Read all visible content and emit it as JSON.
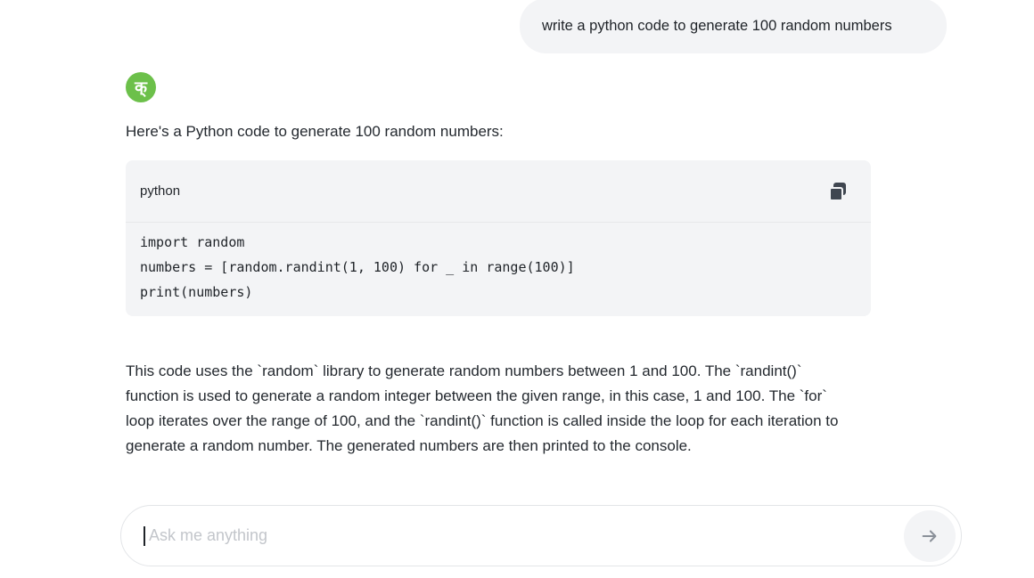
{
  "conversation": {
    "user_message": "write a python code to generate 100 random numbers",
    "assistant": {
      "avatar_glyph": "क्",
      "avatar_color": "#6cc04a",
      "intro": "Here's a Python code to generate 100 random numbers:",
      "code": {
        "language": "python",
        "copy_icon": "copy-icon",
        "lines": [
          "import random",
          "numbers = [random.randint(1, 100) for _ in range(100)]",
          "print(numbers)"
        ]
      },
      "explanation": [
        "This code uses the `random` library to generate random numbers between 1 and 100. The `randint()`",
        "function is used to generate a random integer between the given range, in this case, 1 and 100. The `for`",
        "loop iterates over the range of 100, and the `randint()` function is called inside the loop for each iteration to",
        "generate a random number. The generated numbers are then printed to the console."
      ]
    }
  },
  "composer": {
    "placeholder": "Ask me anything",
    "value": "",
    "send_icon": "arrow-right-icon"
  }
}
